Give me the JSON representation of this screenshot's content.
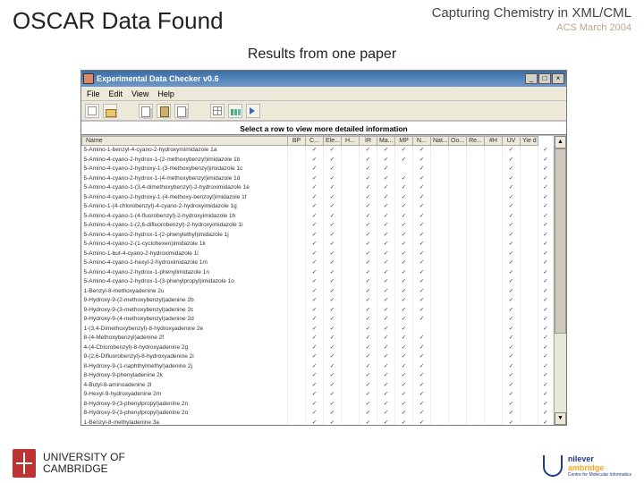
{
  "slide": {
    "title": "OSCAR Data Found",
    "subtitle": "Results from one paper",
    "header_r1": "Capturing Chemistry in XML/CML",
    "header_r2": "ACS March 2004"
  },
  "app": {
    "title": "Experimental Data Checker v0.6",
    "menu": [
      "File",
      "Edit",
      "View",
      "Help"
    ],
    "instruction": "Select a row to view more detailed information",
    "columns": [
      "Name",
      "BP",
      "C...",
      "Ele...",
      "H...",
      "IR",
      "Ma...",
      "MP",
      "N...",
      "Nat...",
      "Oo...",
      "Re...",
      "#H",
      "UV",
      "Yie d"
    ],
    "rows": [
      {
        "name": "5-Amino-1-benzyl-4-cyano-2-hydroxymimidazole 1a",
        "ticks": [
          0,
          1,
          1,
          0,
          1,
          1,
          1,
          1,
          0,
          0,
          0,
          0,
          1,
          0,
          1
        ]
      },
      {
        "name": "5-Amino-4-cyano-2-hydrox-1-(2-methoxybenzyl)imidazole 1b",
        "ticks": [
          0,
          1,
          1,
          0,
          1,
          1,
          1,
          1,
          0,
          0,
          0,
          0,
          1,
          0,
          1
        ]
      },
      {
        "name": "5-Amino-4-cyano-2-hydroxy-1-(3-methoxybenzyl)imidazole 1c",
        "ticks": [
          0,
          1,
          1,
          0,
          1,
          1,
          0,
          1,
          0,
          0,
          0,
          0,
          1,
          0,
          1
        ]
      },
      {
        "name": "5-Amino-4-cyano-2-hydrox-1-(4-methoxybenzyl)imidazole 1d",
        "ticks": [
          0,
          1,
          1,
          0,
          1,
          1,
          1,
          1,
          0,
          0,
          0,
          0,
          1,
          0,
          1
        ]
      },
      {
        "name": "5-Amino-4-cyano-1-(3,4-dimethoxybenzyl)-2-hydroximidazole 1e",
        "ticks": [
          0,
          1,
          1,
          0,
          1,
          1,
          1,
          1,
          0,
          0,
          0,
          0,
          1,
          0,
          1
        ]
      },
      {
        "name": "5-Amino-4-cyano-2-hydroxy-1-(4-methoxy-benzoyl)imidazole 1f",
        "ticks": [
          0,
          1,
          1,
          0,
          1,
          1,
          1,
          1,
          0,
          0,
          0,
          0,
          1,
          0,
          1
        ]
      },
      {
        "name": "5-Amino-1-(4-chlorobenzyl)-4-cyano-2-hydroxyimidazole 1g",
        "ticks": [
          0,
          1,
          1,
          0,
          1,
          1,
          1,
          1,
          0,
          0,
          0,
          0,
          1,
          0,
          1
        ]
      },
      {
        "name": "5-Amino-4-cyano-1-(4-fluorobenzyl)-2-hydroxyimidazole 1h",
        "ticks": [
          0,
          1,
          1,
          0,
          1,
          1,
          1,
          1,
          0,
          0,
          0,
          0,
          1,
          0,
          1
        ]
      },
      {
        "name": "5-Amino-4-cyano-1-(2,6-difluorobenzyl)-2-hydroxyimidazole 1i",
        "ticks": [
          0,
          1,
          1,
          0,
          1,
          1,
          1,
          1,
          0,
          0,
          0,
          0,
          1,
          0,
          1
        ]
      },
      {
        "name": "5-Amino-4-cyano-2-hydrox-1-(2-phenylethyl)imidazole 1j",
        "ticks": [
          0,
          1,
          1,
          0,
          1,
          1,
          1,
          1,
          0,
          0,
          0,
          0,
          1,
          0,
          1
        ]
      },
      {
        "name": "5-Amino-4-cyano-2-(1-cyclohexen)imidazole 1k",
        "ticks": [
          0,
          1,
          1,
          0,
          1,
          1,
          1,
          1,
          0,
          0,
          0,
          0,
          1,
          0,
          1
        ]
      },
      {
        "name": "5-Amino-1-but-4-cyano-2-hydroximidazole 1l",
        "ticks": [
          0,
          1,
          1,
          0,
          1,
          1,
          1,
          1,
          0,
          0,
          0,
          0,
          1,
          0,
          1
        ]
      },
      {
        "name": "5-Amino-4-cyano-1-hexyl-2-hydroximidazole 1m",
        "ticks": [
          0,
          1,
          1,
          0,
          1,
          1,
          1,
          1,
          0,
          0,
          0,
          0,
          1,
          0,
          1
        ]
      },
      {
        "name": "5-Amino-4-cyano-2-hydrox-1-phenylimidazole 1n",
        "ticks": [
          0,
          1,
          1,
          0,
          1,
          1,
          1,
          1,
          0,
          0,
          0,
          0,
          1,
          0,
          1
        ]
      },
      {
        "name": "5-Amino-4-cyano-2-hydrox-1-(3-phenylpropyl)imidazole 1o",
        "ticks": [
          0,
          1,
          1,
          0,
          1,
          1,
          1,
          1,
          0,
          0,
          0,
          0,
          1,
          0,
          1
        ]
      },
      {
        "name": "1-Benzyl-8-methoxyadenine 2u",
        "ticks": [
          0,
          1,
          1,
          0,
          1,
          1,
          1,
          1,
          0,
          0,
          0,
          0,
          1,
          0,
          1
        ]
      },
      {
        "name": "9-Hydroxy-9-(2-methoxybenzyl)adenine 2b",
        "ticks": [
          0,
          1,
          1,
          0,
          1,
          1,
          1,
          1,
          0,
          0,
          0,
          0,
          1,
          0,
          1
        ]
      },
      {
        "name": "9-Hydroxy-9-(3-methoxybenzyl)adenine 2c",
        "ticks": [
          0,
          1,
          1,
          0,
          1,
          1,
          1,
          1,
          0,
          0,
          0,
          0,
          1,
          0,
          1
        ]
      },
      {
        "name": "9-Hydroxy-9-(4-methoxybenzyl)adenine 2d",
        "ticks": [
          0,
          1,
          1,
          0,
          1,
          1,
          1,
          1,
          0,
          0,
          0,
          0,
          1,
          0,
          1
        ]
      },
      {
        "name": "1-(3,4-Dimethoxybenzyl)-8-hydroxyadenine 2e",
        "ticks": [
          0,
          1,
          1,
          0,
          1,
          1,
          1,
          0,
          0,
          0,
          0,
          0,
          1,
          0,
          1
        ]
      },
      {
        "name": "8-(4-Methoxybenzyl)adenine 2f",
        "ticks": [
          0,
          1,
          1,
          0,
          1,
          1,
          1,
          1,
          0,
          0,
          0,
          0,
          1,
          0,
          1
        ]
      },
      {
        "name": "4-(4-Chlorobenzyl)-8-hydroxyadenine 2g",
        "ticks": [
          0,
          1,
          1,
          0,
          1,
          1,
          1,
          1,
          0,
          0,
          0,
          0,
          1,
          0,
          1
        ]
      },
      {
        "name": "9-(2,6-Difluorobenzyl)-8-hydroxyadenine 2i",
        "ticks": [
          0,
          1,
          1,
          0,
          1,
          1,
          1,
          1,
          0,
          0,
          0,
          0,
          1,
          0,
          1
        ]
      },
      {
        "name": "8-Hydroxy-9-(1-naphthylmethyl)adenine 2j",
        "ticks": [
          0,
          1,
          1,
          0,
          1,
          1,
          1,
          1,
          0,
          0,
          0,
          0,
          1,
          0,
          1
        ]
      },
      {
        "name": "8-Hydroxy-9-phenyladenine 2k",
        "ticks": [
          0,
          1,
          1,
          0,
          1,
          1,
          1,
          1,
          0,
          0,
          0,
          0,
          1,
          0,
          1
        ]
      },
      {
        "name": "4-Butyl-8-aminoadenine 2l",
        "ticks": [
          0,
          1,
          1,
          0,
          1,
          1,
          1,
          1,
          0,
          0,
          0,
          0,
          1,
          0,
          1
        ]
      },
      {
        "name": "9-Hexyl-9-hydroxyadenine 2m",
        "ticks": [
          0,
          1,
          1,
          0,
          1,
          1,
          1,
          1,
          0,
          0,
          0,
          0,
          1,
          0,
          1
        ]
      },
      {
        "name": "8-Hydroxy-9-(3-phenylpropyl)adenine 2n",
        "ticks": [
          0,
          1,
          1,
          0,
          1,
          1,
          1,
          1,
          0,
          0,
          0,
          0,
          1,
          0,
          1
        ]
      },
      {
        "name": "8-Hydroxy-9-(3-phenylpropyl)adenine 2o",
        "ticks": [
          0,
          1,
          1,
          0,
          1,
          1,
          1,
          1,
          0,
          0,
          0,
          0,
          1,
          0,
          1
        ]
      },
      {
        "name": "1-Benzyl-8-methyladenine 3a",
        "ticks": [
          0,
          1,
          1,
          0,
          1,
          1,
          1,
          1,
          0,
          0,
          0,
          0,
          1,
          0,
          1
        ]
      }
    ],
    "win_buttons": {
      "min": "_",
      "max": "□",
      "close": "×"
    },
    "scroll": {
      "up": "▲",
      "down": "▼"
    }
  },
  "footer": {
    "cambridge_l1": "UNIVERSITY OF",
    "cambridge_l2": "CAMBRIDGE",
    "uc_l1": "nilever",
    "uc_l2": "ambridge",
    "uc_l3": "Centre for Molecular Informatics"
  }
}
